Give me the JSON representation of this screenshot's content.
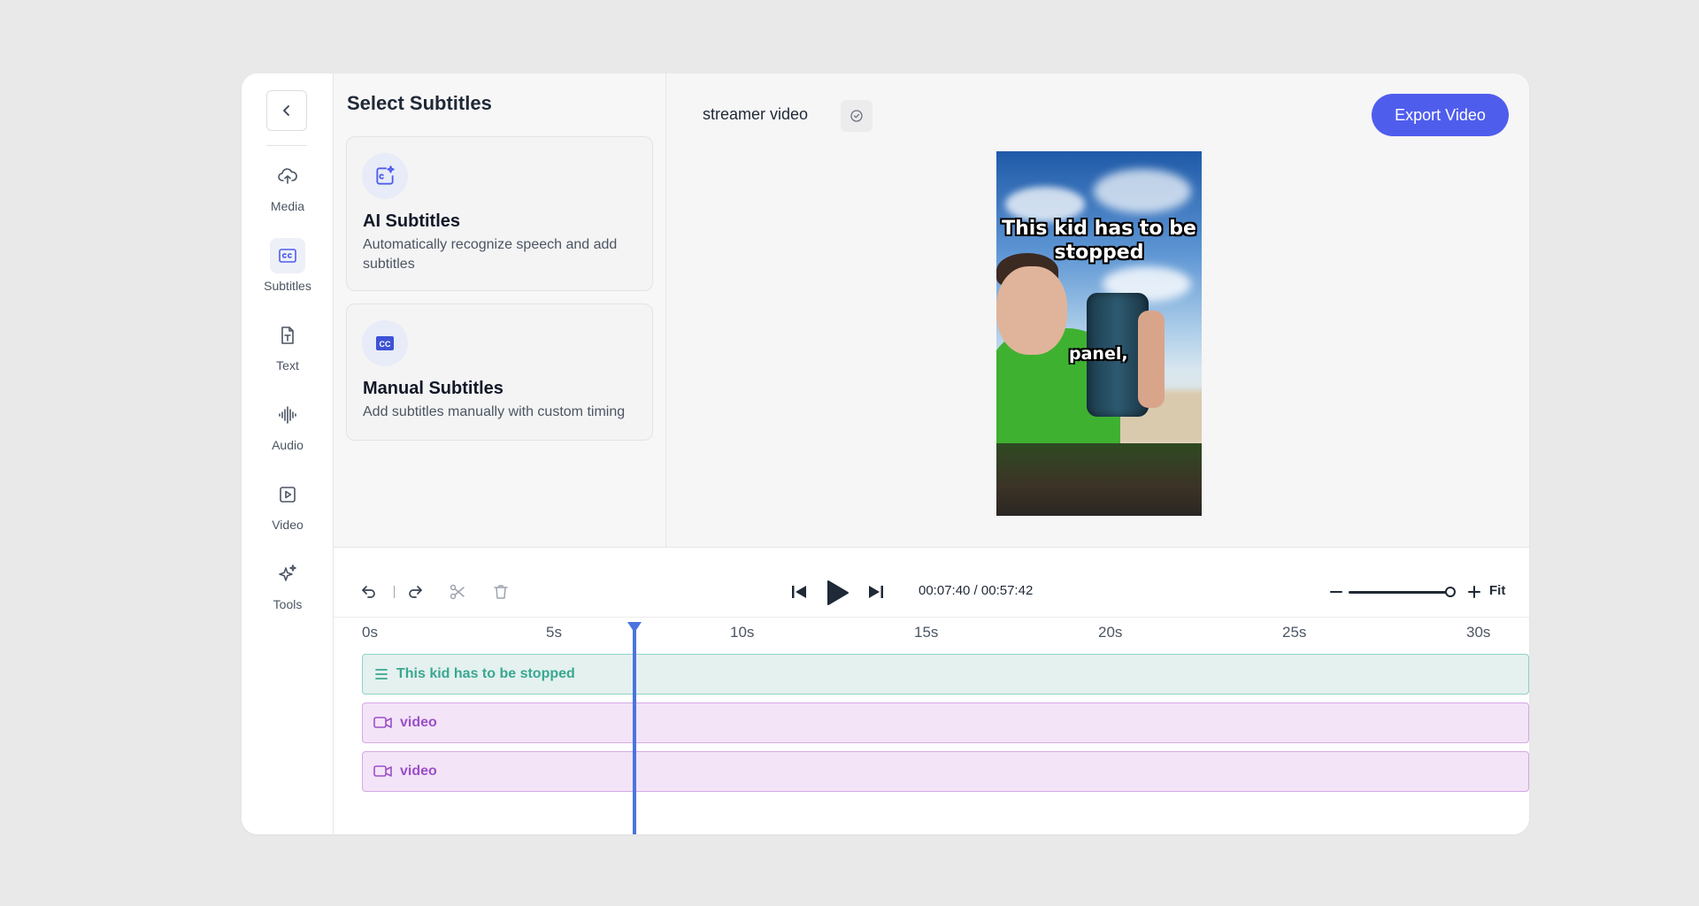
{
  "rail": {
    "items": [
      {
        "label": "Media",
        "icon": "cloud-upload-icon"
      },
      {
        "label": "Subtitles",
        "icon": "closed-captions-icon",
        "active": true
      },
      {
        "label": "Text",
        "icon": "text-file-icon"
      },
      {
        "label": "Audio",
        "icon": "audio-waveform-icon"
      },
      {
        "label": "Video",
        "icon": "video-play-icon"
      },
      {
        "label": "Tools",
        "icon": "sparkles-icon"
      }
    ]
  },
  "panel": {
    "title": "Select Subtitles",
    "cards": [
      {
        "title": "AI Subtitles",
        "description": "Automatically recognize speech and add subtitles",
        "icon": "ai-caption-icon"
      },
      {
        "title": "Manual Subtitles",
        "description": "Add subtitles manually with custom timing",
        "icon": "cc-icon"
      }
    ]
  },
  "preview": {
    "project_name": "streamer video",
    "export_label": "Export Video",
    "caption_top": "This kid has to be stopped",
    "caption_word": "panel,"
  },
  "timeline": {
    "time_readout": "00:07:40 / 00:57:42",
    "fit_label": "Fit",
    "zoom_level": 1.0,
    "ticks": [
      "0s",
      "5s",
      "10s",
      "15s",
      "20s",
      "25s",
      "30s"
    ],
    "tracks": [
      {
        "type": "subtitle",
        "label": "This kid has to be stopped"
      },
      {
        "type": "video",
        "label": "video"
      },
      {
        "type": "video",
        "label": "video"
      }
    ],
    "playhead_seconds": 7.4
  },
  "colors": {
    "accent": "#4f5ded",
    "playhead": "#4a74de",
    "subtitle_track": "#3aa791",
    "video_track": "#9b4fc9"
  }
}
